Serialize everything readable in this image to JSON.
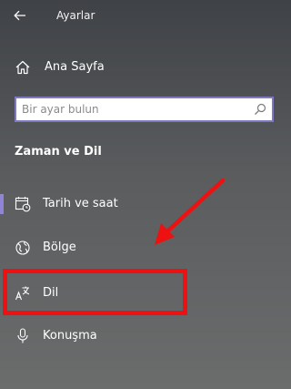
{
  "window": {
    "title": "Ayarlar"
  },
  "home": {
    "label": "Ana Sayfa"
  },
  "search": {
    "placeholder": "Bir ayar bulun",
    "value": ""
  },
  "section": {
    "title": "Zaman ve Dil"
  },
  "nav": {
    "items": [
      {
        "label": "Tarih ve saat",
        "icon": "calendar-clock-icon",
        "active": true
      },
      {
        "label": "Bölge",
        "icon": "globe-icon",
        "active": false
      },
      {
        "label": "Dil",
        "icon": "language-icon",
        "active": false
      },
      {
        "label": "Konuşma",
        "icon": "microphone-icon",
        "active": false
      }
    ]
  },
  "colors": {
    "accent": "#8e86d4",
    "annotation": "#ee1111",
    "search_border": "#7d7ac2"
  }
}
